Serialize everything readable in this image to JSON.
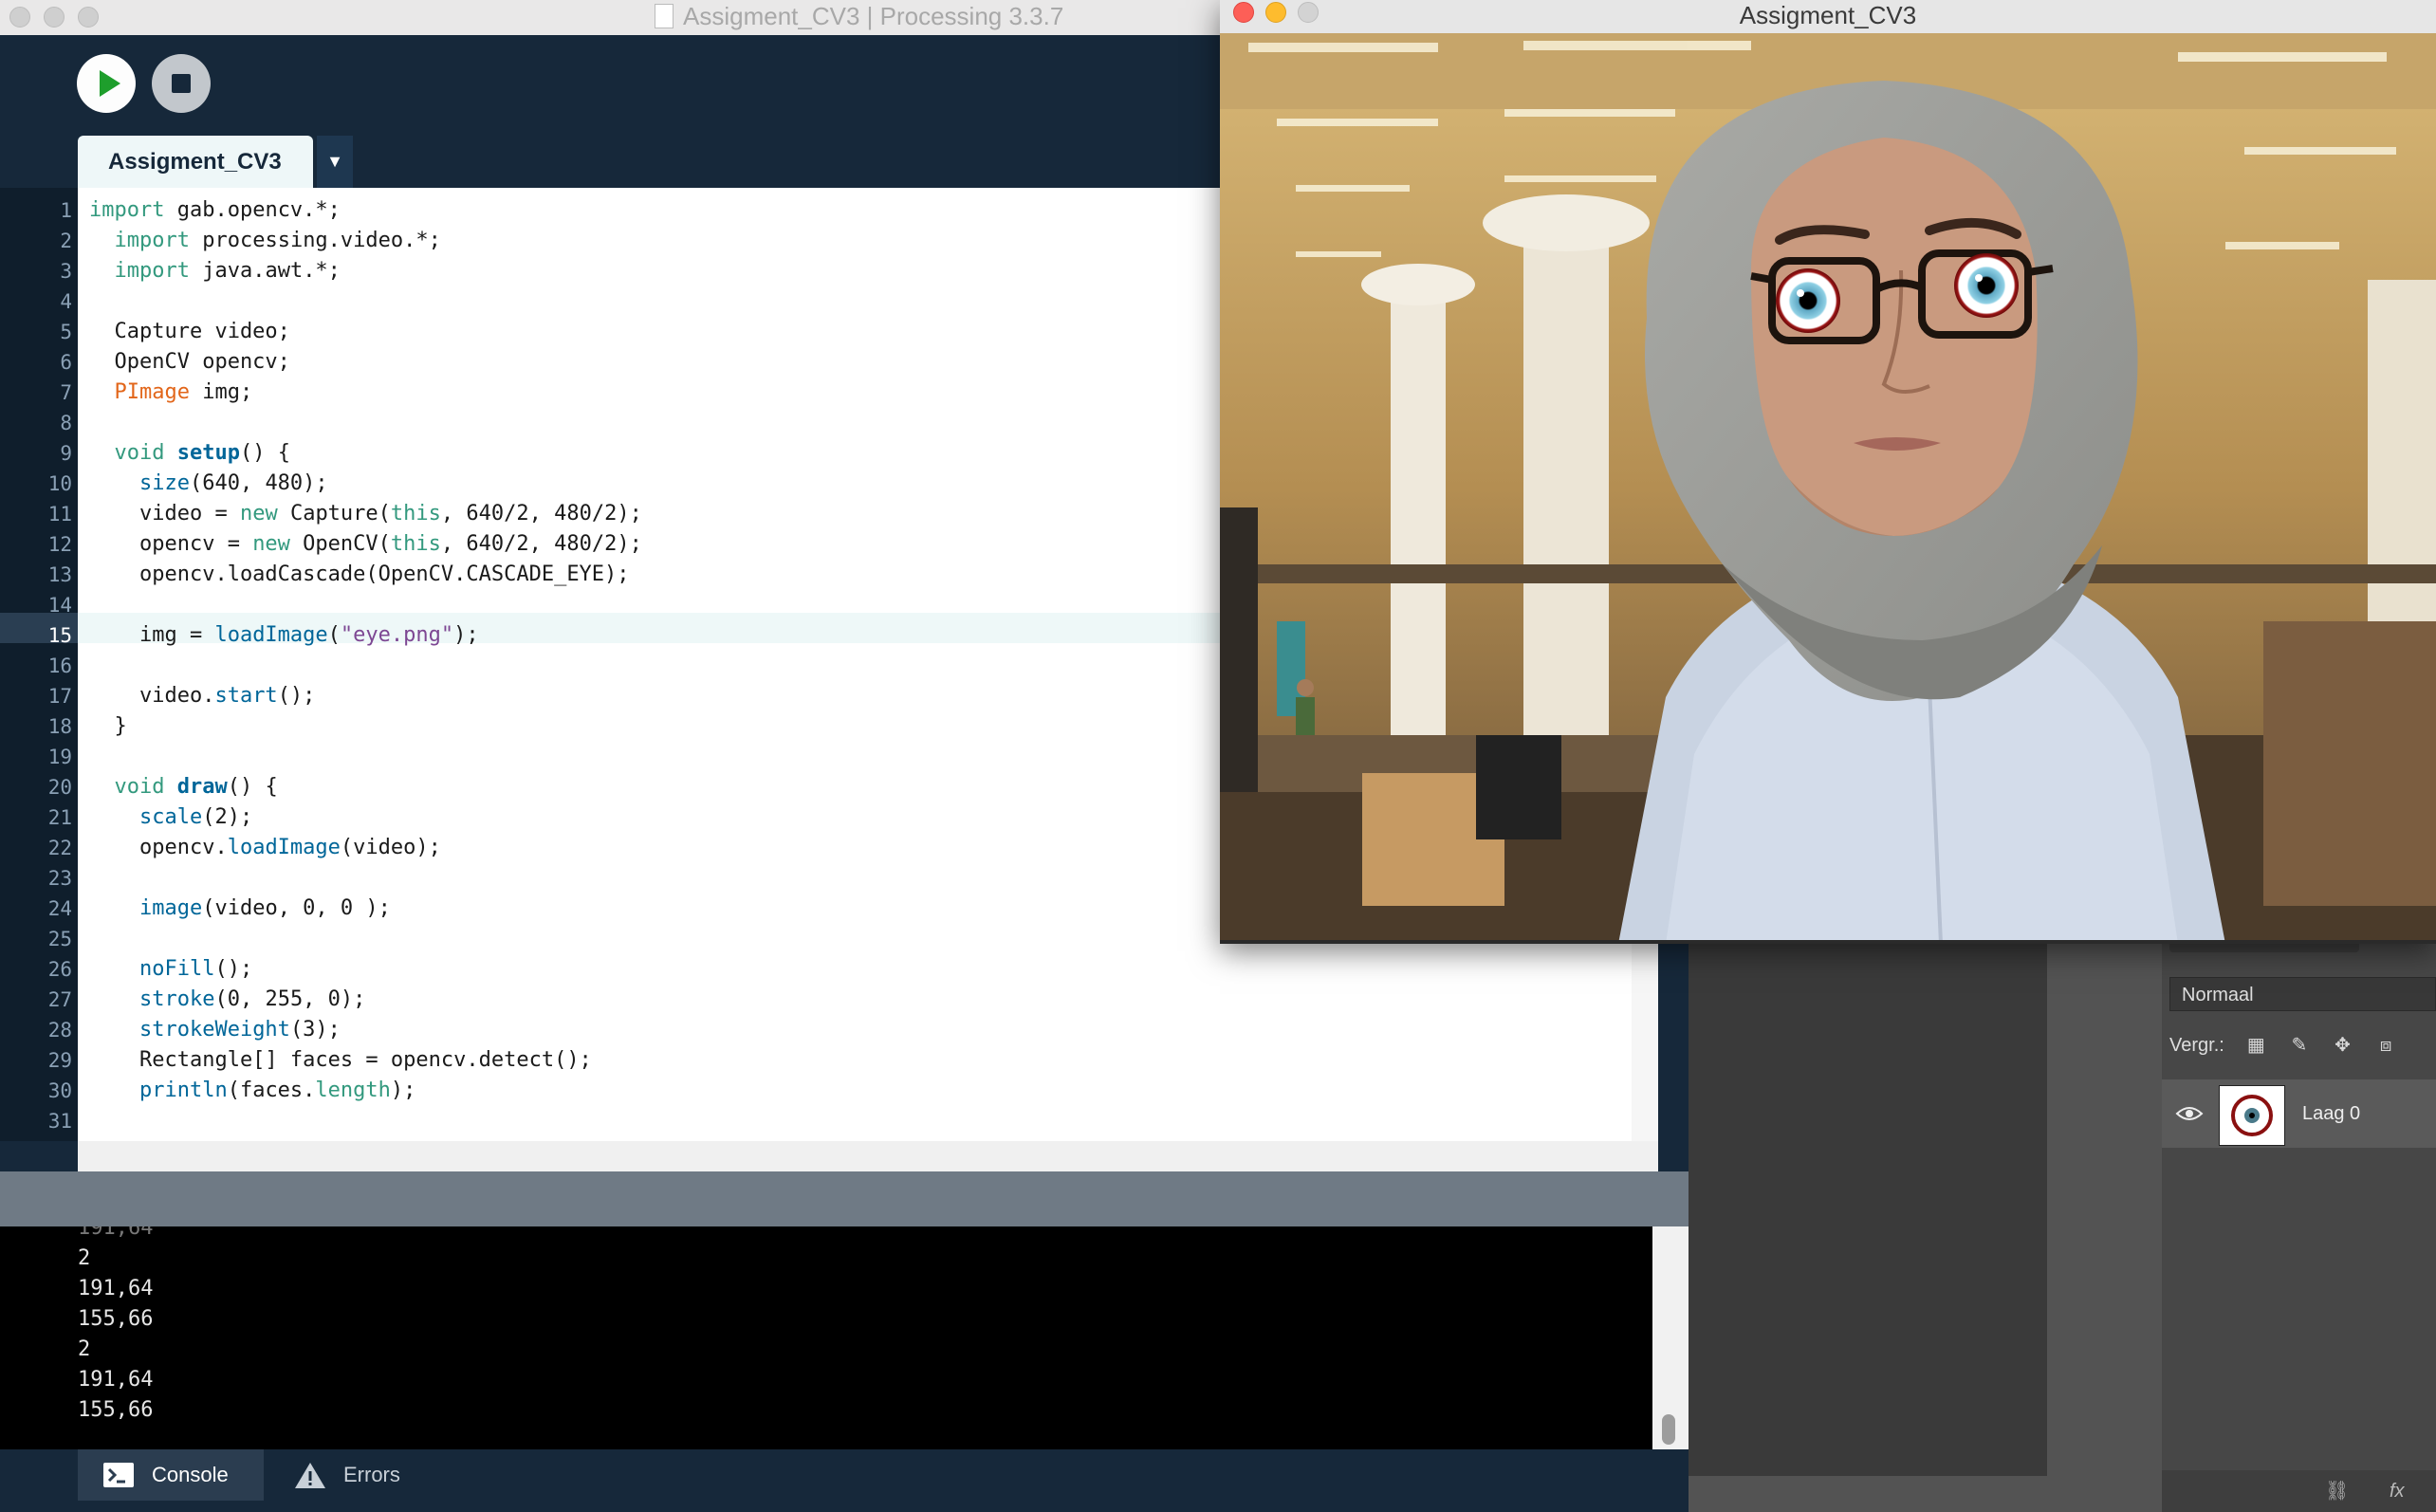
{
  "ide": {
    "title": "Assigment_CV3 | Processing 3.3.7",
    "tab": "Assigment_CV3",
    "tab_menu": "▼",
    "line_numbers": [
      "1",
      "2",
      "3",
      "4",
      "5",
      "6",
      "7",
      "8",
      "9",
      "10",
      "11",
      "12",
      "13",
      "14",
      "15",
      "16",
      "17",
      "18",
      "19",
      "20",
      "21",
      "22",
      "23",
      "24",
      "25",
      "26",
      "27",
      "28",
      "29",
      "30",
      "31"
    ],
    "current_line": 15,
    "code": {
      "l1": "import gab.opencv.*;",
      "l2": "  import processing.video.*;",
      "l3": "  import java.awt.*;",
      "l5": "  Capture video;",
      "l6": "  OpenCV opencv;",
      "l7": "  PImage img;",
      "l9": "  void setup() {",
      "l10": "    size(640, 480);",
      "l11": "    video = new Capture(this, 640/2, 480/2);",
      "l12": "    opencv = new OpenCV(this, 640/2, 480/2);",
      "l13": "    opencv.loadCascade(OpenCV.CASCADE_EYE);",
      "l15": "    img = loadImage(\"eye.png\");",
      "l17": "    video.start();",
      "l18": "  }",
      "l20": "  void draw() {",
      "l21": "    scale(2);",
      "l22": "    opencv.loadImage(video);",
      "l24": "    image(video, 0, 0 );",
      "l26": "    noFill();",
      "l27": "    stroke(0, 255, 0);",
      "l28": "    strokeWeight(3);",
      "l29": "    Rectangle[] faces = opencv.detect();",
      "l30": "    println(faces.length);"
    },
    "console_lines": [
      "2",
      "191,64",
      "155,66",
      "2",
      "191,64",
      "155,66"
    ],
    "footer_tabs": {
      "console": "Console",
      "errors": "Errors"
    }
  },
  "sketch": {
    "title": "Assigment_CV3"
  },
  "photoshop": {
    "blend_mode": "Normaal",
    "lock_label": "Vergr.:",
    "layer_name": "Laag 0",
    "fx_label": "fx"
  },
  "colors": {
    "ide_bg": "#16283a",
    "keyword": "#33997e",
    "function": "#006699",
    "type": "#e2661a",
    "string": "#7d4793"
  },
  "icons": [
    "play-icon",
    "stop-icon",
    "console-icon",
    "warning-icon",
    "eye-visibility-icon",
    "link-icon"
  ]
}
